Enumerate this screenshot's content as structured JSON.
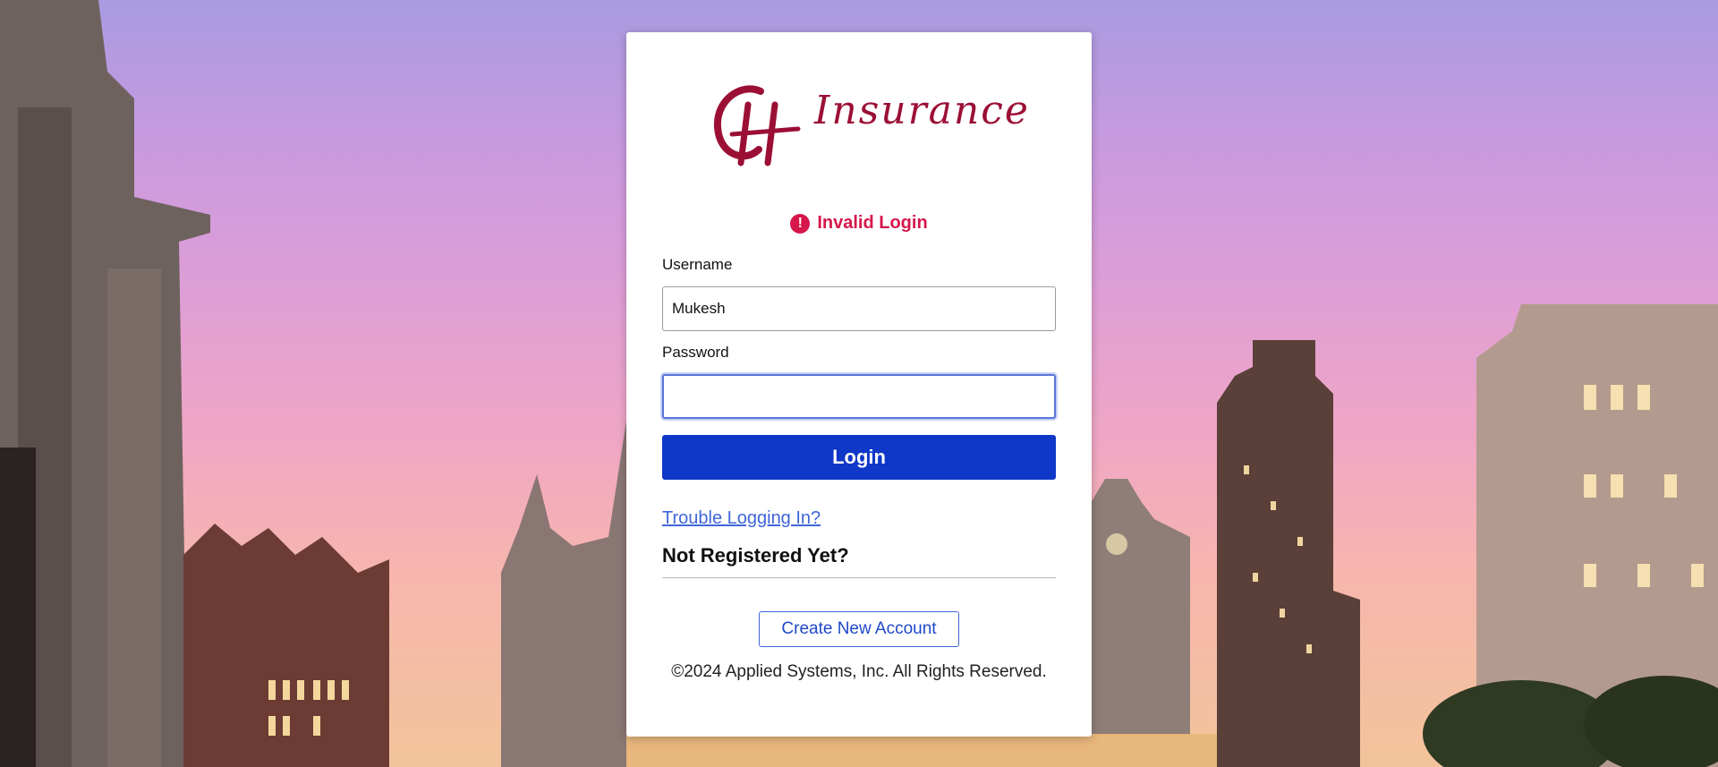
{
  "brand": {
    "wordmark": "Insurance",
    "accent": "#9b0f35"
  },
  "error": {
    "icon": "exclamation-circle-icon",
    "message": "Invalid Login",
    "color": "#d6174b"
  },
  "form": {
    "username_label": "Username",
    "username_value": "Mukesh",
    "password_label": "Password",
    "password_value": "",
    "login_label": "Login",
    "login_color": "#0f37c8"
  },
  "links": {
    "trouble": "Trouble Logging In?",
    "not_registered": "Not Registered Yet?",
    "create_account": "Create New Account"
  },
  "footer": {
    "copyright": "©2024 Applied Systems, Inc. All Rights Reserved."
  }
}
